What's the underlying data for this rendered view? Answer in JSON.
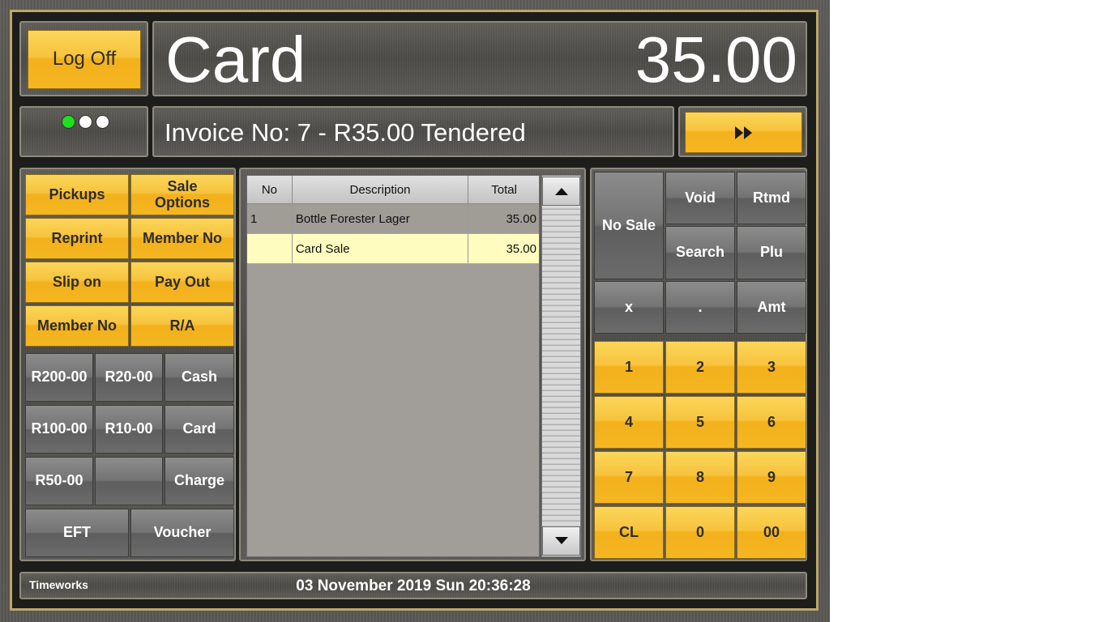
{
  "header": {
    "logoff_label": "Log Off",
    "mode_title": "Card",
    "amount": "35.00"
  },
  "status_bar": {
    "invoice_text": "Invoice No: 7 - R35.00 Tendered",
    "indicator_colors": [
      "#1ee01e",
      "#ffffff",
      "#ffffff"
    ],
    "forward_icon": "fast-forward-icon"
  },
  "function_buttons": [
    {
      "label": "Pickups"
    },
    {
      "label": "Sale Options"
    },
    {
      "label": "Reprint"
    },
    {
      "label": "Member No"
    },
    {
      "label": "Slip on"
    },
    {
      "label": "Pay Out"
    },
    {
      "label": "Member No"
    },
    {
      "label": "R/A"
    }
  ],
  "tender_buttons": [
    {
      "label": "R200-00"
    },
    {
      "label": "R20-00"
    },
    {
      "label": "Cash"
    },
    {
      "label": "R100-00"
    },
    {
      "label": "R10-00"
    },
    {
      "label": "Card"
    },
    {
      "label": "R50-00"
    },
    {
      "label": ""
    },
    {
      "label": "Charge"
    },
    {
      "label": "EFT"
    },
    {
      "label": "Voucher"
    }
  ],
  "items_table": {
    "columns": [
      "No",
      "Description",
      "Total"
    ],
    "rows": [
      {
        "no": "1",
        "description": "Bottle Forester Lager",
        "total": "35.00"
      },
      {
        "no": "",
        "description": "Card Sale",
        "total": "35.00"
      }
    ],
    "selected_row_color": "#fffcc0"
  },
  "keypad": {
    "no_sale": "No Sale",
    "void": "Void",
    "rtmd": "Rtmd",
    "search": "Search",
    "plu": "Plu",
    "multiply": "x",
    "decimal": ".",
    "amt": "Amt",
    "digits": [
      "1",
      "2",
      "3",
      "4",
      "5",
      "6",
      "7",
      "8",
      "9"
    ],
    "clear": "CL",
    "zero": "0",
    "double_zero": "00"
  },
  "footer": {
    "brand": "Timeworks",
    "datetime": "03 November 2019 Sun 20:36:28"
  },
  "colors": {
    "accent_yellow": "#f7c33d",
    "frame_gold": "#b9a86a"
  }
}
